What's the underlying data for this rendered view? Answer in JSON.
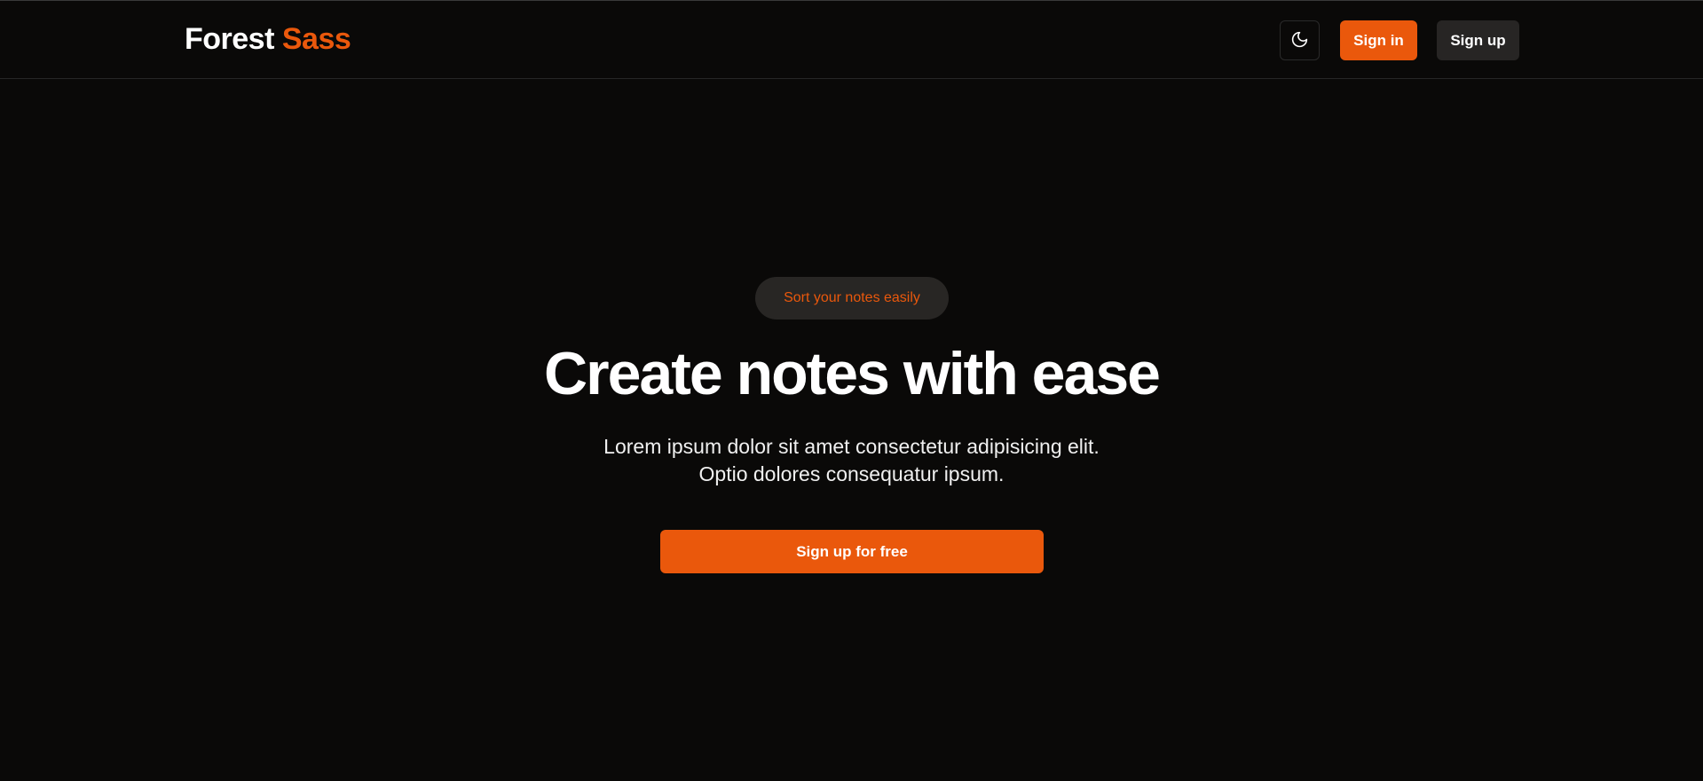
{
  "navbar": {
    "brand": {
      "first": "Forest",
      "second": "Sass"
    },
    "theme_toggle_icon": "moon-icon",
    "sign_in_label": "Sign in",
    "sign_up_label": "Sign up"
  },
  "hero": {
    "pill_text": "Sort your notes easily",
    "title": "Create notes with ease",
    "description_lines": [
      "Lorem ipsum dolor sit amet consectetur adipisicing elit.",
      "Optio dolores consequatur ipsum."
    ],
    "cta_label": "Sign up for free"
  },
  "colors": {
    "background": "#0a0908",
    "accent": "#ea580c",
    "secondary_button": "#272524",
    "pill_background": "#282624"
  }
}
